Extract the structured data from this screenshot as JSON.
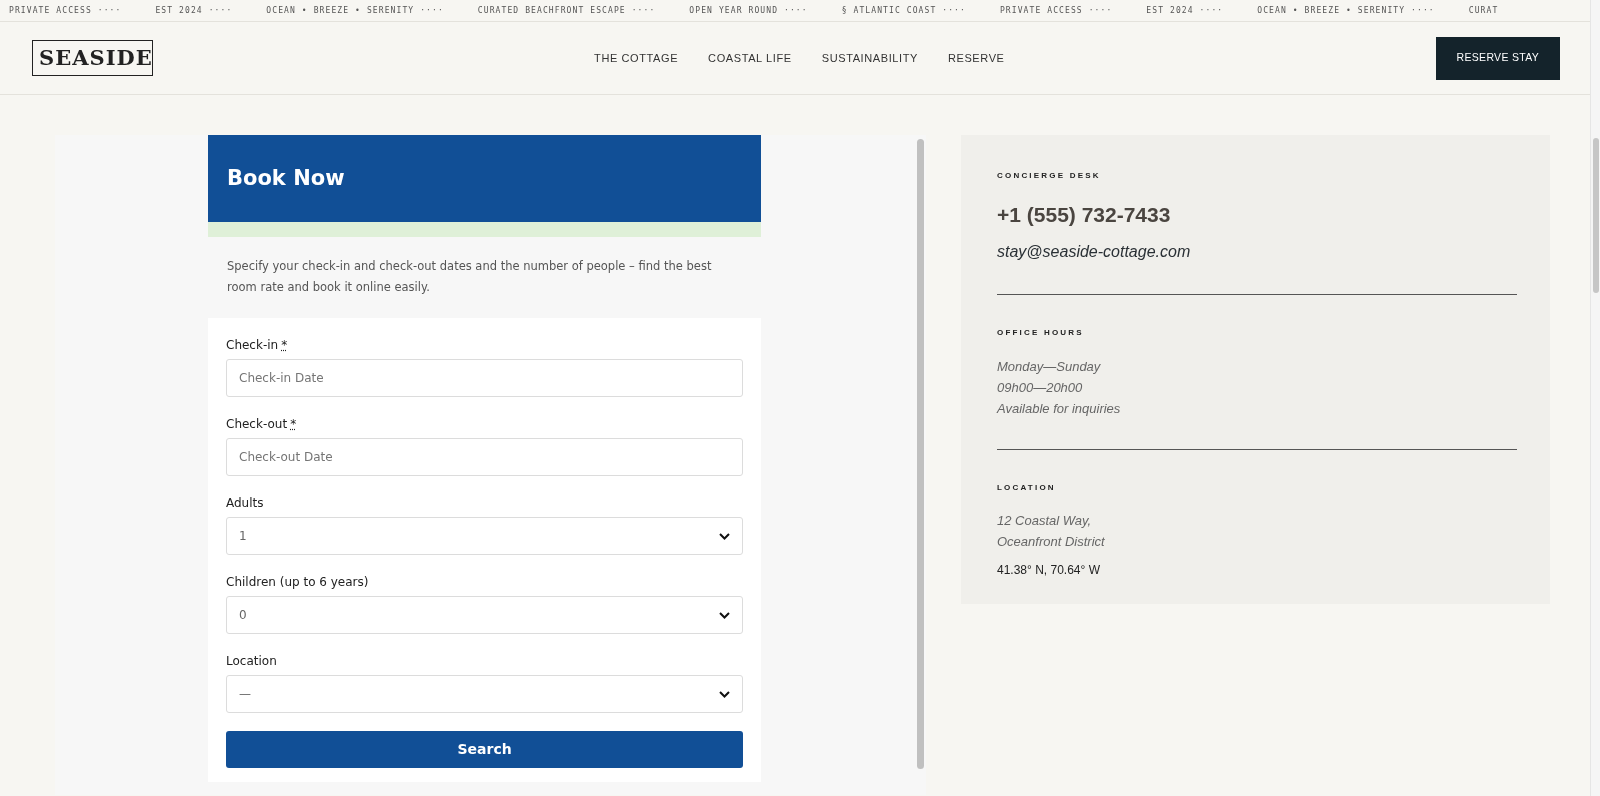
{
  "ticker": [
    "PRIVATE ACCESS ····",
    "EST 2024 ····",
    "OCEAN • BREEZE • SERENITY ····",
    "CURATED BEACHFRONT ESCAPE ····",
    "OPEN YEAR ROUND ····",
    "§ ATLANTIC COAST ····",
    "PRIVATE ACCESS ····",
    "EST 2024 ····",
    "OCEAN • BREEZE • SERENITY ····",
    "CURAT"
  ],
  "header": {
    "logo": "SEASIDE",
    "nav": [
      "THE COTTAGE",
      "COASTAL LIFE",
      "SUSTAINABILITY",
      "RESERVE"
    ],
    "cta": "RESERVE STAY"
  },
  "booking": {
    "title": "Book Now",
    "description": "Specify your check-in and check-out dates and the number of people – find the best room rate and book it online easily.",
    "fields": [
      {
        "kind": "text",
        "label": "Check-in",
        "required": true,
        "placeholder": "Check-in Date"
      },
      {
        "kind": "text",
        "label": "Check-out",
        "required": true,
        "placeholder": "Check-out Date"
      },
      {
        "kind": "select",
        "label": "Adults",
        "required": false,
        "value": "1"
      },
      {
        "kind": "select",
        "label": "Children (up to 6 years)",
        "required": false,
        "value": "0"
      },
      {
        "kind": "select",
        "label": "Location",
        "required": false,
        "value": "—"
      }
    ],
    "required_mark": "*",
    "button": "Search"
  },
  "contact": {
    "sections": [
      {
        "heading": "CONCIERGE DESK",
        "phone": "+1 (555) 732-7433",
        "email": "stay@seaside-cottage.com"
      },
      {
        "heading": "OFFICE HOURS",
        "lines": [
          "Monday—Sunday",
          "09h00—20h00",
          "Available for inquiries"
        ]
      },
      {
        "heading": "LOCATION",
        "lines": [
          "12 Coastal Way,",
          "Oceanfront District"
        ],
        "coords": "41.38° N, 70.64° W"
      }
    ]
  }
}
